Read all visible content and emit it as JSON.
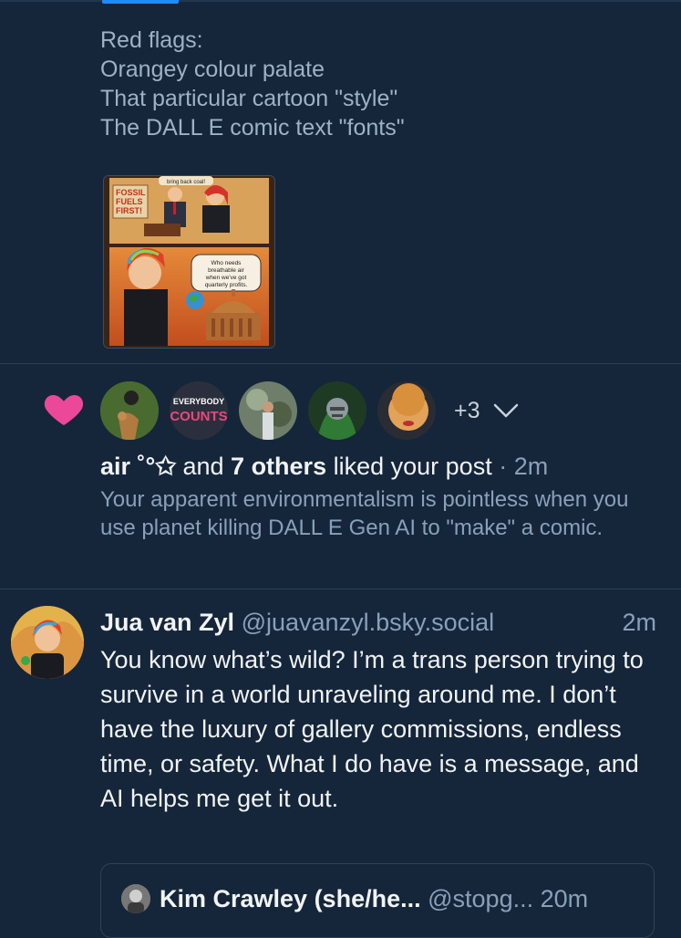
{
  "post": {
    "lines": [
      "Red flags:",
      "",
      "Orangey colour palate",
      "That particular cartoon \"style\"",
      "The DALL E comic text \"fonts\""
    ],
    "comic": {
      "banner": "bring back coal!",
      "sign": "FOSSIL FUELS FIRST!",
      "bubble": "Who needs breathable air when we've got quarterly profits."
    }
  },
  "like_notification": {
    "extra_count": "+3",
    "avatar_badge": "EVERYBODY COUNTS",
    "actor": "air ˚°✩",
    "middle": "and",
    "others": "7 others",
    "action": "liked your post",
    "sep": "·",
    "time": "2m",
    "snippet": "Your apparent environmentalism is pointless when you use planet killing DALL E Gen AI to \"make\" a comic."
  },
  "reply": {
    "name": "Jua van Zyl",
    "handle": "@juavanzyl.bsky.social",
    "time": "2m",
    "text": "You know what’s wild? I’m a trans person trying to survive in a world unraveling around me. I don’t have the luxury of gallery commissions, endless time, or safety. What I do have is a message, and AI helps me get it out.",
    "quote": {
      "name": "Kim Crawley (she/he...",
      "handle": "@stopg...",
      "time": "20m"
    }
  },
  "colors": {
    "background": "#15263a",
    "accent": "#208bfe",
    "heart": "#ec4899",
    "muted_text": "#8aa0b6"
  }
}
